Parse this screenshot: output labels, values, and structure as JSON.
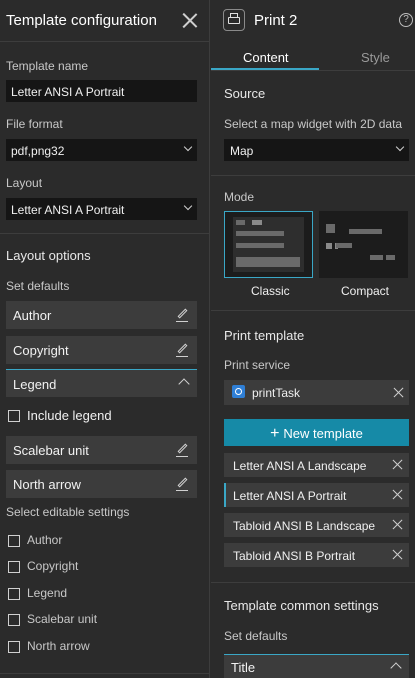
{
  "left_panel": {
    "title": "Template configuration",
    "template_name_label": "Template name",
    "template_name_value": "Letter ANSI A Portrait",
    "file_format_label": "File format",
    "file_format_value": "pdf,png32",
    "layout_label": "Layout",
    "layout_value": "Letter ANSI A Portrait",
    "layout_options_title": "Layout options",
    "set_defaults_label": "Set defaults",
    "defaults": {
      "author": "Author",
      "copyright": "Copyright",
      "legend": "Legend",
      "include_legend": "Include legend",
      "scalebar_unit": "Scalebar unit",
      "north_arrow": "North arrow"
    },
    "editable_label": "Select editable settings",
    "editable": [
      "Author",
      "Copyright",
      "Legend",
      "Scalebar unit",
      "North arrow"
    ]
  },
  "right_panel": {
    "title": "Print 2",
    "help_glyph": "?",
    "tabs": [
      "Content",
      "Style"
    ],
    "active_tab": "Content",
    "source_title": "Source",
    "source_sub": "Select a map widget with 2D data",
    "source_value": "Map",
    "mode_title": "Mode",
    "modes": [
      "Classic",
      "Compact"
    ],
    "selected_mode": "Classic",
    "print_template_title": "Print template",
    "print_service_label": "Print service",
    "print_service_value": "printTask",
    "new_template_label": "New template",
    "templates": [
      "Letter ANSI A Landscape",
      "Letter ANSI A Portrait",
      "Tabloid ANSI B Landscape",
      "Tabloid ANSI B Portrait"
    ],
    "selected_template": "Letter ANSI A Portrait",
    "common_settings_title": "Template common settings",
    "set_defaults_label": "Set defaults",
    "title_row": "Title"
  },
  "colors": {
    "accent": "#3aa7c6",
    "button": "#168aa7",
    "panel": "#2b2b2b",
    "input": "#151515",
    "row": "#3c3c3c"
  }
}
